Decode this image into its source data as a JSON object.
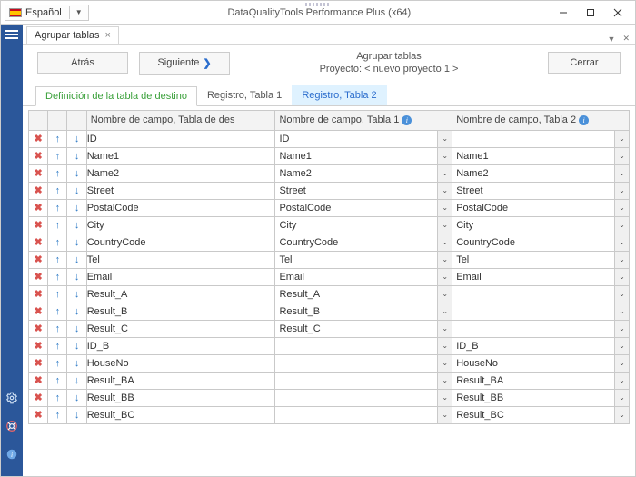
{
  "titlebar": {
    "language": "Español",
    "app_title": "DataQualityTools Performance Plus (x64)"
  },
  "doc_tab": {
    "label": "Agrupar tablas"
  },
  "toolbar": {
    "back_label": "Atrás",
    "next_label": "Siguiente",
    "close_label": "Cerrar"
  },
  "header": {
    "title": "Agrupar tablas",
    "project": "Proyecto: < nuevo proyecto 1 >"
  },
  "inner_tabs": {
    "t0": "Definición de la tabla de destino",
    "t1": "Registro, Tabla 1",
    "t2": "Registro, Tabla 2"
  },
  "grid": {
    "hdr_dest": "Nombre de campo, Tabla de des",
    "hdr_t1": "Nombre de campo, Tabla 1",
    "hdr_t2": "Nombre de campo, Tabla 2",
    "rows": [
      {
        "dest": "ID",
        "t1": "ID",
        "t2": ""
      },
      {
        "dest": "Name1",
        "t1": "Name1",
        "t2": "Name1"
      },
      {
        "dest": "Name2",
        "t1": "Name2",
        "t2": "Name2"
      },
      {
        "dest": "Street",
        "t1": "Street",
        "t2": "Street"
      },
      {
        "dest": "PostalCode",
        "t1": "PostalCode",
        "t2": "PostalCode"
      },
      {
        "dest": "City",
        "t1": "City",
        "t2": "City"
      },
      {
        "dest": "CountryCode",
        "t1": "CountryCode",
        "t2": "CountryCode"
      },
      {
        "dest": "Tel",
        "t1": "Tel",
        "t2": "Tel"
      },
      {
        "dest": "Email",
        "t1": "Email",
        "t2": "Email"
      },
      {
        "dest": "Result_A",
        "t1": "Result_A",
        "t2": ""
      },
      {
        "dest": "Result_B",
        "t1": "Result_B",
        "t2": ""
      },
      {
        "dest": "Result_C",
        "t1": "Result_C",
        "t2": ""
      },
      {
        "dest": "ID_B",
        "t1": "",
        "t2": "ID_B"
      },
      {
        "dest": "HouseNo",
        "t1": "",
        "t2": "HouseNo"
      },
      {
        "dest": "Result_BA",
        "t1": "",
        "t2": "Result_BA"
      },
      {
        "dest": "Result_BB",
        "t1": "",
        "t2": "Result_BB"
      },
      {
        "dest": "Result_BC",
        "t1": "",
        "t2": "Result_BC"
      }
    ]
  }
}
